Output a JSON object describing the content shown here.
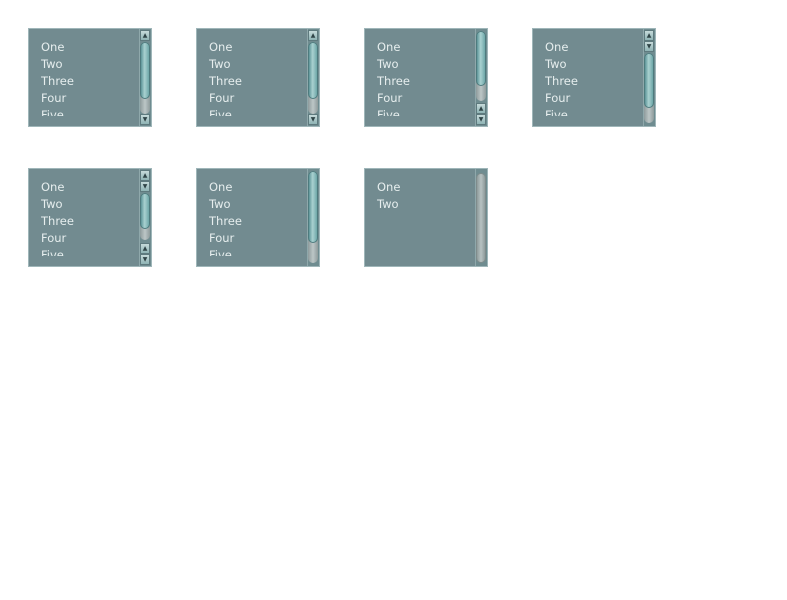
{
  "listboxes": [
    {
      "items": [
        "One",
        "Two",
        "Three",
        "Four",
        "Five"
      ]
    },
    {
      "items": [
        "One",
        "Two",
        "Three",
        "Four",
        "Five"
      ]
    },
    {
      "items": [
        "One",
        "Two",
        "Three",
        "Four",
        "Five"
      ]
    },
    {
      "items": [
        "One",
        "Two",
        "Three",
        "Four",
        "Five"
      ]
    },
    {
      "items": [
        "One",
        "Two",
        "Three",
        "Four",
        "Five"
      ]
    },
    {
      "items": [
        "One",
        "Two",
        "Three",
        "Four",
        "Five"
      ]
    },
    {
      "items": [
        "One",
        "Two"
      ]
    }
  ],
  "arrow_glyphs": {
    "up": "▲",
    "down": "▼"
  },
  "colors": {
    "list_bg": "#728b90",
    "text": "#e6eeee",
    "thumb": "#a9d1d0"
  }
}
